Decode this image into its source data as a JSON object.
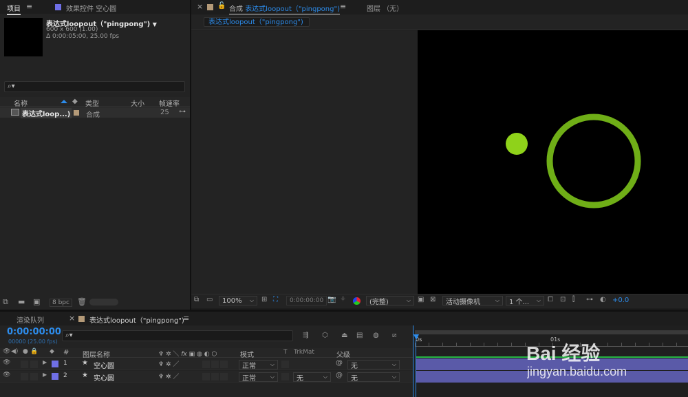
{
  "project_panel": {
    "tab_project": "项目",
    "tab_menu": "≡",
    "tab_effects": "效果控件 空心圆",
    "comp_name": "表达式loopout（\"pingpong\")",
    "comp_size": "600 x 600 (1.00)",
    "comp_duration": "Δ 0:00:05:00, 25.00 fps",
    "search_placeholder": "",
    "col_name": "名称",
    "col_type": "类型",
    "col_size": "大小",
    "col_fps": "帧速率",
    "row_name": "表达式loop...)",
    "row_type": "合成",
    "row_fps": "25",
    "bpc": "8 bpc"
  },
  "comp_panel": {
    "tab_close": "×",
    "tab_prefix": "合成",
    "tab_name": "表达式loopout（\"pingpong\")",
    "tab_menu": "≡",
    "layer_tab": "图层 （无）",
    "breadcrumb": "表达式loopout（\"pingpong\")",
    "zoom": "100%",
    "timecode": "0:00:00:00",
    "resolution": "(完整)",
    "camera": "活动摄像机",
    "views": "1 个...",
    "exposure": "+0.0"
  },
  "timeline": {
    "tab_render": "渲染队列",
    "tab_close": "×",
    "tab_comp": "表达式loopout（\"pingpong\")",
    "tab_menu": "≡",
    "current_time": "0:00:00:00",
    "frame_info": "00000 (25.00 fps)",
    "col_hash": "#",
    "col_layer_name": "图层名称",
    "col_mode": "模式",
    "col_t": "T",
    "col_trkmat": "TrkMat",
    "col_parent": "父级",
    "ruler_0": "0s",
    "ruler_1": "01s",
    "layers": [
      {
        "num": "1",
        "name": "空心圆",
        "mode": "正常",
        "trkmat": "",
        "parent": "无",
        "color": "#6f6fe6"
      },
      {
        "num": "2",
        "name": "实心圆",
        "mode": "正常",
        "trkmat": "无",
        "parent": "无",
        "color": "#6f6fe6"
      }
    ]
  },
  "watermark": {
    "brand": "Bai 经验",
    "url": "jingyan.baidu.com"
  },
  "colors": {
    "accent": "#2d8ceb",
    "circle_fill": "#8fd21a",
    "ring_stroke": "#6fae17",
    "layer_label": "#6f6fe6"
  }
}
